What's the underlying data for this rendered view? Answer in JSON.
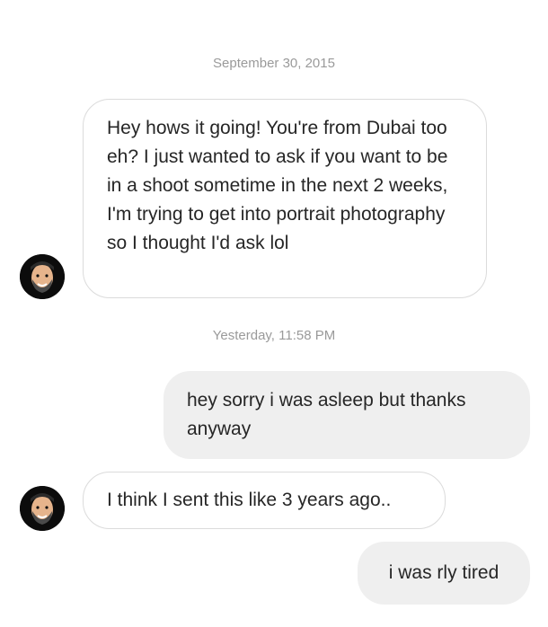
{
  "thread": {
    "timestamp_1": "September 30, 2015",
    "message_1": "Hey hows it going! You're from Dubai too eh? I just wanted to ask if you want to be in a shoot sometime in the next 2 weeks, I'm trying to get into portrait photography so I thought I'd ask lol",
    "timestamp_2": "Yesterday, 11:58 PM",
    "message_2": "hey sorry i was asleep but thanks anyway",
    "message_3": "I think I sent this like 3 years ago..",
    "message_4": "i was rly tired"
  },
  "colors": {
    "incoming_border": "#dbdbdb",
    "outgoing_bg": "#efefef",
    "timestamp_text": "#9a9a9a",
    "message_text": "#262626",
    "avatar_bg": "#0c0c0c"
  }
}
